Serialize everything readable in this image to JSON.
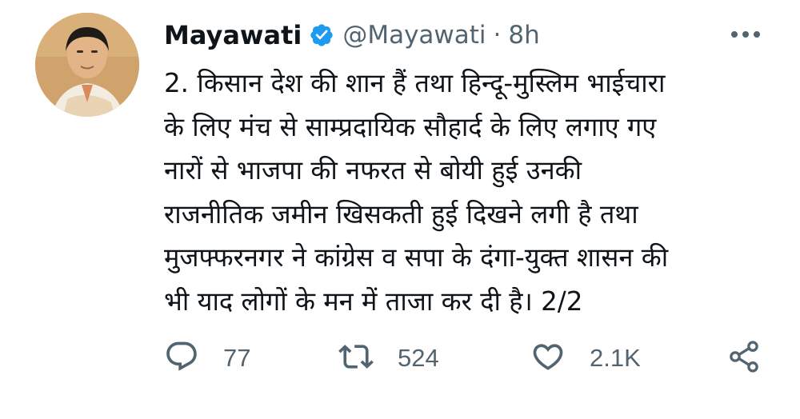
{
  "tweet": {
    "author": {
      "name": "Mayawati",
      "handle": "@Mayawati",
      "verified": true,
      "avatar_icon": "profile-photo"
    },
    "separator": "·",
    "time": "8h",
    "text_lines": [
      "2. किसान देश की शान हैं तथा हिन्दू-मुस्लिम भाईचारा",
      "के लिए मंच से साम्प्रदायिक सौहार्द के लिए लगाए गए",
      "नारों से भाजपा की नफरत से बोयी हुई उनकी",
      "राजनीतिक जमीन खिसकती हुई दिखने लगी है तथा",
      "मुजफ्फरनगर ने कांग्रेस व सपा के दंगा-युक्त शासन की",
      "भी याद लोगों के मन में ताजा कर दी है। 2/2"
    ],
    "actions": {
      "reply": {
        "icon": "reply-icon",
        "count": "77"
      },
      "retweet": {
        "icon": "retweet-icon",
        "count": "524"
      },
      "like": {
        "icon": "heart-icon",
        "count": "2.1K"
      },
      "share": {
        "icon": "share-icon"
      }
    },
    "more_icon": "more-horizontal-icon"
  },
  "colors": {
    "text": "#0f1419",
    "secondary": "#536471",
    "verified": "#1d9bf0",
    "background": "#ffffff"
  }
}
